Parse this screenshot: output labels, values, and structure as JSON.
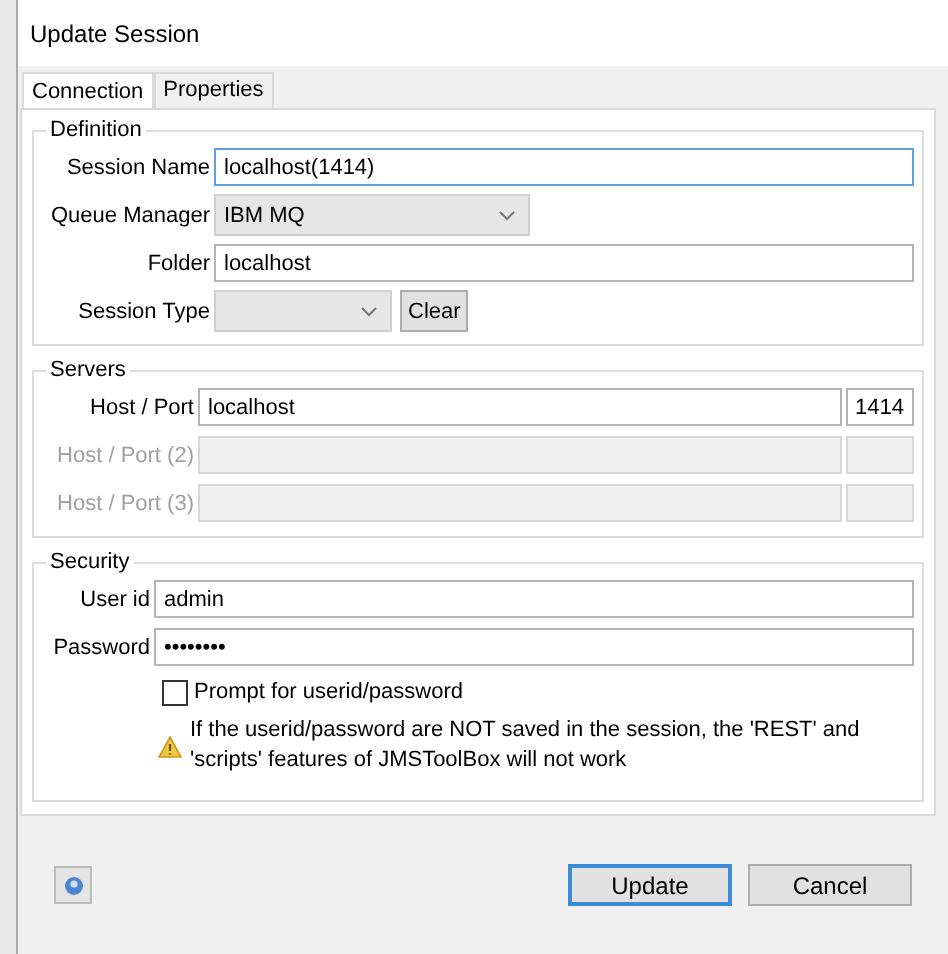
{
  "window": {
    "title": "Update Session"
  },
  "tabs": [
    {
      "label": "Connection",
      "selected": true
    },
    {
      "label": "Properties",
      "selected": false
    }
  ],
  "definition": {
    "title": "Definition",
    "fields": [
      {
        "kind": "text",
        "label": "Session Name",
        "value": "localhost(1414)",
        "focused": true
      },
      {
        "kind": "select",
        "label": "Queue Manager",
        "value": "IBM MQ",
        "focused": false
      },
      {
        "kind": "text",
        "label": "Folder",
        "value": "localhost",
        "focused": false
      },
      {
        "kind": "select_button",
        "label": "Session Type",
        "button": "Clear",
        "focused": false
      }
    ]
  },
  "servers": {
    "title": "Servers",
    "rows": [
      {
        "label": "Host / Port",
        "host": "localhost",
        "port": "1414",
        "disabled": false
      },
      {
        "label": "Host / Port (2)",
        "disabled": true
      },
      {
        "label": "Host / Port (3)",
        "disabled": true
      }
    ]
  },
  "security": {
    "title": "Security",
    "fields": [
      {
        "label": "User id",
        "value": "admin"
      },
      {
        "label": "Password",
        "value": "••••••••"
      }
    ],
    "checkbox": {
      "label": "Prompt for userid/password",
      "checked": false
    },
    "warning": "If the userid/password are NOT saved in the session, the 'REST' and 'scripts' features of JMSToolBox will not work"
  },
  "buttons": [
    {
      "label": "Update",
      "default": true
    },
    {
      "label": "Cancel",
      "default": false
    }
  ]
}
